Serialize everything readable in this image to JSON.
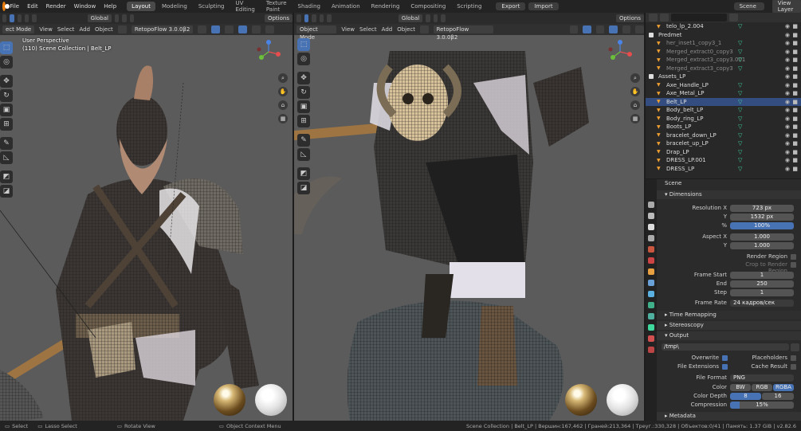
{
  "topbar": {
    "menus": [
      "File",
      "Edit",
      "Render",
      "Window",
      "Help"
    ],
    "workspaces": [
      {
        "label": "Layout",
        "active": true
      },
      {
        "label": "Modeling",
        "active": false
      },
      {
        "label": "Sculpting",
        "active": false
      },
      {
        "label": "UV Editing",
        "active": false
      },
      {
        "label": "Texture Paint",
        "active": false
      },
      {
        "label": "Shading",
        "active": false
      },
      {
        "label": "Animation",
        "active": false
      },
      {
        "label": "Rendering",
        "active": false
      },
      {
        "label": "Compositing",
        "active": false
      },
      {
        "label": "Scripting",
        "active": false
      }
    ],
    "export_label": "Export",
    "import_label": "Import",
    "scene_label": "Scene",
    "view_layer_label": "View Layer"
  },
  "viewport_left": {
    "mode": "ect Mode",
    "menus": [
      "View",
      "Select",
      "Add",
      "Object"
    ],
    "orientation": "Global",
    "addon": "RetopoFlow 3.0.0β2",
    "options": "Options",
    "perspective": "User Perspective",
    "collection": "(110) Scene Collection | Belt_LP"
  },
  "viewport_right": {
    "mode": "Object Mode",
    "menus": [
      "View",
      "Select",
      "Add",
      "Object"
    ],
    "orientation": "Global",
    "addon": "RetopoFlow 3.0.0β2",
    "options": "Options"
  },
  "outliner": {
    "search_placeholder": "",
    "rows": [
      {
        "name": "telo_lp_2.004",
        "dim": false,
        "indent": 1,
        "tri": true,
        "sel": false
      },
      {
        "name": "Predmet",
        "dim": false,
        "indent": 0,
        "tri": false,
        "sel": false,
        "collection": true
      },
      {
        "name": "her_inset1_copy3_1",
        "dim": true,
        "indent": 1,
        "tri": true,
        "sel": false
      },
      {
        "name": "Merged_extract0_copy3",
        "dim": true,
        "indent": 1,
        "tri": true,
        "sel": false
      },
      {
        "name": "Merged_extract3_copy3.001",
        "dim": true,
        "indent": 1,
        "tri": true,
        "sel": false
      },
      {
        "name": "Merged_extract3_copy3",
        "dim": true,
        "indent": 1,
        "tri": true,
        "sel": false
      },
      {
        "name": "Assets_LP",
        "dim": false,
        "indent": 0,
        "tri": false,
        "sel": false,
        "collection": true
      },
      {
        "name": "Axe_Handle_LP",
        "dim": false,
        "indent": 1,
        "tri": true,
        "sel": false
      },
      {
        "name": "Axe_Metal_LP",
        "dim": false,
        "indent": 1,
        "tri": true,
        "sel": false
      },
      {
        "name": "Belt_LP",
        "dim": false,
        "indent": 1,
        "tri": true,
        "sel": true
      },
      {
        "name": "Body_belt_LP",
        "dim": false,
        "indent": 1,
        "tri": true,
        "sel": false
      },
      {
        "name": "Body_ring_LP",
        "dim": false,
        "indent": 1,
        "tri": true,
        "sel": false
      },
      {
        "name": "Boots_LP",
        "dim": false,
        "indent": 1,
        "tri": true,
        "sel": false
      },
      {
        "name": "bracelet_down_LP",
        "dim": false,
        "indent": 1,
        "tri": true,
        "sel": false
      },
      {
        "name": "bracelet_up_LP",
        "dim": false,
        "indent": 1,
        "tri": true,
        "sel": false
      },
      {
        "name": "Drap_LP",
        "dim": false,
        "indent": 1,
        "tri": true,
        "sel": false
      },
      {
        "name": "DRESS_LP.001",
        "dim": false,
        "indent": 1,
        "tri": true,
        "sel": false
      },
      {
        "name": "DRESS_LP",
        "dim": false,
        "indent": 1,
        "tri": true,
        "sel": false
      }
    ]
  },
  "properties": {
    "scene_label": "Scene",
    "dimensions_label": "Dimensions",
    "resolution_x_label": "Resolution X",
    "resolution_x": "723 px",
    "y_label": "Y",
    "resolution_y": "1532 px",
    "percent_label": "%",
    "percent": "100%",
    "aspect_x_label": "Aspect X",
    "aspect_x": "1.000",
    "aspect_y_label": "Y",
    "aspect_y": "1.000",
    "render_region_label": "Render Region",
    "crop_label": "Crop to Render Region",
    "frame_start_label": "Frame Start",
    "frame_start": "1",
    "end_label": "End",
    "frame_end": "250",
    "step_label": "Step",
    "step": "1",
    "frame_rate_label": "Frame Rate",
    "frame_rate": "24 кадров/сек",
    "time_remapping_label": "Time Remapping",
    "stereoscopy_label": "Stereoscopy",
    "output_label": "Output",
    "output_path": "/tmp\\",
    "overwrite_label": "Overwrite",
    "placeholders_label": "Placeholders",
    "file_extensions_label": "File Extensions",
    "cache_result_label": "Cache Result",
    "file_format_label": "File Format",
    "file_format": "PNG",
    "color_label": "Color",
    "color_options": [
      "BW",
      "RGB",
      "RGBA"
    ],
    "color_depth_label": "Color Depth",
    "color_depth_options": [
      "8",
      "16"
    ],
    "compression_label": "Compression",
    "compression": "15%",
    "compression_fraction": 0.15,
    "metadata_label": "Metadata"
  },
  "statusbar": {
    "select": "Select",
    "lasso": "Lasso Select",
    "rotate": "Rotate View",
    "context": "Object Context Menu",
    "stats": "Scene Collection | Belt_LP | Вершин:167,462 | Граней:213,364 | Треуг.:330,328 | Объектов:0/41 | Память: 1.37 GiB | v2.82.6"
  },
  "colors": {
    "accent": "#4772b3",
    "selected_row": "#334d80",
    "object_icon": "#f0a030",
    "modifier_icon": "#3fd99e"
  }
}
